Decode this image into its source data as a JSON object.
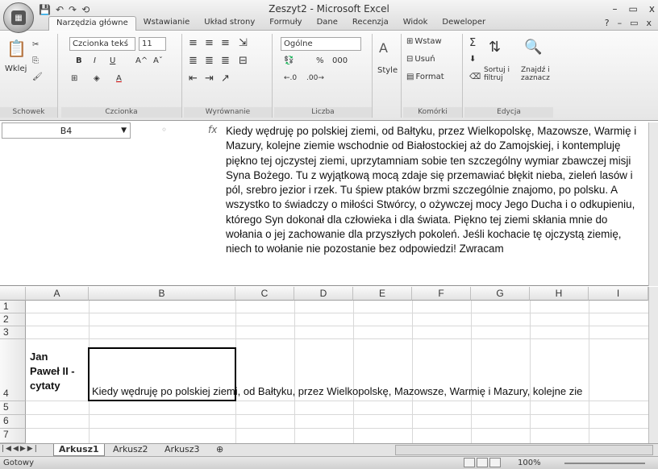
{
  "window": {
    "title": "Zeszyt2 - Microsoft Excel",
    "controls": [
      "–",
      "▭",
      "x"
    ]
  },
  "quick_access": [
    "💾",
    "↶",
    "↷",
    "⟲"
  ],
  "tabs": [
    "Narzędzia główne",
    "Wstawianie",
    "Układ strony",
    "Formuły",
    "Dane",
    "Recenzja",
    "Widok",
    "Deweloper"
  ],
  "ribbon": {
    "clipboard": {
      "paste": "Wklej",
      "label": "Schowek"
    },
    "font": {
      "name": "Czcionka tekś",
      "size": "11",
      "bold": "B",
      "italic": "I",
      "underline": "U",
      "grow": "A^",
      "shrink": "Aˇ",
      "label": "Czcionka"
    },
    "alignment": {
      "label": "Wyrównanie"
    },
    "number": {
      "format": "Ogólne",
      "percent": "%",
      "thousands": "000",
      "label": "Liczba"
    },
    "styles": {
      "style": "Style"
    },
    "cells": {
      "insert": "Wstaw",
      "delete": "Usuń",
      "format": "Format",
      "label": "Komórki"
    },
    "editing": {
      "sort": "Sortuj i filtruj",
      "find": "Znajdź i zaznacz",
      "label": "Edycja"
    }
  },
  "namebox": "B4",
  "formula": "Kiedy wędruję po polskiej ziemi, od Bałtyku, przez Wielkopolskę, Mazowsze, Warmię i Mazury, kolejne ziemie wschodnie od Białostockiej aż do Zamojskiej, i kontempluję piękno tej ojczystej ziemi, uprzytamniam sobie ten szczególny wymiar zbawczej misji Syna Bożego. Tu z wyjątkową mocą zdaje się przemawiać błękit nieba, zieleń lasów i pól, srebro jezior i rzek. Tu śpiew ptaków brzmi szczególnie znajomo, po polsku. A wszystko to świadczy o miłości Stwórcy, o ożywczej mocy Jego Ducha i o odkupieniu, którego Syn dokonał dla człowieka i dla świata. Piękno tej ziemi skłania mnie do wołania o jej zachowanie dla przyszłych pokoleń. Jeśli kochacie tę ojczystą ziemię, niech to wołanie nie pozostanie bez odpowiedzi! Zwracam",
  "columns": [
    "A",
    "B",
    "C",
    "D",
    "E",
    "F",
    "G",
    "H",
    "I"
  ],
  "rows": [
    "1",
    "2",
    "3",
    "4",
    "5",
    "6",
    "7"
  ],
  "cells": {
    "A4": "Jan Paweł II - cytaty",
    "A4_lines": [
      "Jan",
      "Paweł II -",
      "cytaty"
    ],
    "B4": "Kiedy wędruję po polskiej ziemi, od Bałtyku, przez Wielkopolskę, Mazowsze, Warmię i Mazury, kolejne zie"
  },
  "sheets": [
    "Arkusz1",
    "Arkusz2",
    "Arkusz3"
  ],
  "status": {
    "ready": "Gotowy",
    "zoom": "100%"
  }
}
